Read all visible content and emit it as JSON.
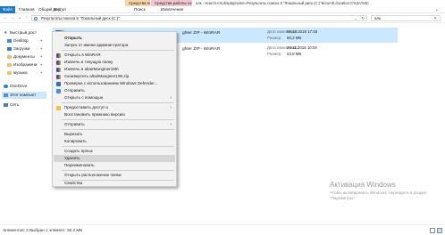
{
  "ribbon": {
    "contextual_tabs": [
      "Средства поиска",
      "Средства работы со сжатыми папками"
    ],
    "title_path": "алк - search-ms:displayname=Результаты поиска в \"Локальный диск (C:)\"&crumb=location:C%3A%5C",
    "tabs": [
      "Файл",
      "Главная",
      "Общий доступ",
      "Вид",
      "Поиск",
      "Извлечение"
    ]
  },
  "address_bar": {
    "path": "Результаты поиска в \"Локальный диск (C:)\"",
    "search_value": "алк"
  },
  "navigation": {
    "items": [
      {
        "label": "Быстрый дост",
        "icon": "star-icon"
      },
      {
        "label": "Desktop",
        "icon": "desktop-icon",
        "pinned": true
      },
      {
        "label": "Загрузки",
        "icon": "downloads-icon",
        "pinned": true
      },
      {
        "label": "Документы",
        "icon": "documents-icon",
        "pinned": true
      },
      {
        "label": "Изображени",
        "icon": "pictures-icon",
        "pinned": true
      },
      {
        "label": "музыка",
        "icon": "folder-icon",
        "pinned": true
      },
      {
        "label": "OneDrive",
        "icon": "onedrive-icon"
      },
      {
        "label": "Этот компьют",
        "icon": "computer-icon",
        "selected": true
      },
      {
        "label": "Сеть",
        "icon": "network-icon"
      }
    ]
  },
  "files": [
    {
      "name": "ghter ZIP - WinRAR",
      "date_label": "Дата изменения:",
      "date": "06.12.2018 17:48",
      "size_label": "Размер:",
      "size": "50,2 МБ",
      "selected": true
    },
    {
      "name": "ghter ZIP - WinRAR",
      "date_label": "Дата изменения:",
      "date": "20.11.2018 10:04",
      "size_label": "Размер:",
      "size": "53,8 МБ",
      "selected": false
    }
  ],
  "context_menu": {
    "items": [
      {
        "label": "Открыть",
        "bold": true
      },
      {
        "label": "Запуск от имени администратора"
      },
      {
        "label": "Открыть в WinRAR",
        "icon": "winrar-icon"
      },
      {
        "label": "Извлечь в текущую папку",
        "icon": "winrar-icon"
      },
      {
        "label": "Извлечь в altairManginer195\\",
        "icon": "winrar-icon"
      },
      {
        "label": "Сконвертить altairManginer195.zip",
        "icon": "winrar-icon"
      },
      {
        "label": "Проверка с использованием Windows Defender...",
        "icon": "defender-icon"
      },
      {
        "label": "Отправить",
        "icon": "share-icon"
      },
      {
        "label": "Открыть с помощью",
        "submenu": true
      },
      {
        "label": "Предоставить доступ к",
        "icon": "shield-icon",
        "submenu": true
      },
      {
        "label": "Восстановить прежнюю версию"
      },
      {
        "label": "Отправить",
        "submenu": true
      },
      {
        "label": "Вырезать"
      },
      {
        "label": "Копировать"
      },
      {
        "label": "Создать ярлык"
      },
      {
        "label": "Удалить",
        "highlighted": true
      },
      {
        "label": "Переименовать"
      },
      {
        "label": "Открыть расположение папки"
      },
      {
        "label": "Свойства"
      }
    ]
  },
  "status_bar": {
    "text": "Элементов: 2    Выбран 1 элемент: 50,2 МБ"
  },
  "watermark": {
    "title": "Активация Windows",
    "subtitle": "Чтобы активировать Windows, перейдите в раздел \"Параметры\"."
  }
}
